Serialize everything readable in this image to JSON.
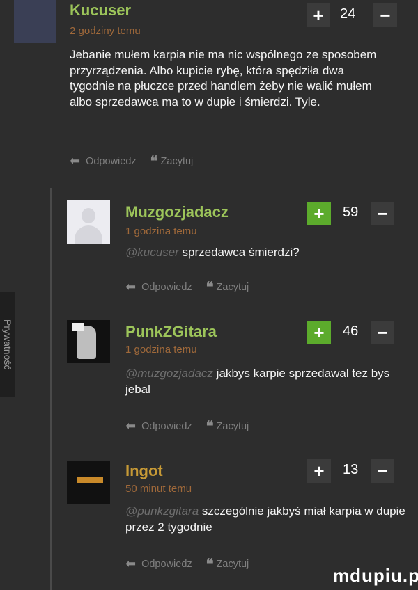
{
  "side_tab": {
    "label": "Prywatność"
  },
  "comments": [
    {
      "username": "Kucuser",
      "timestamp": "2 godziny temu",
      "score": "24",
      "mention": "",
      "text": "Jebanie mułem karpia nie ma nic wspólnego ze sposobem przyrządzenia. Albo kupicie rybę, która spędziła dwa tygodnie na płuczce przed handlem żeby nie walić mułem albo sprzedawca ma to w dupie i śmierdzi. Tyle.",
      "reply_label": "Odpowiedz",
      "quote_label": "Zacytuj"
    },
    {
      "username": "Muzgozjadacz",
      "timestamp": "1 godzina temu",
      "score": "59",
      "mention": "@kucuser",
      "text": "sprzedawca śmierdzi?",
      "reply_label": "Odpowiedz",
      "quote_label": "Zacytuj"
    },
    {
      "username": "PunkZGitara",
      "timestamp": "1 godzina temu",
      "score": "46",
      "mention": "@muzgozjadacz",
      "text": "jakbys karpie sprzedawal tez bys jebal",
      "reply_label": "Odpowiedz",
      "quote_label": "Zacytuj"
    },
    {
      "username": "Ingot",
      "timestamp": "50 minut temu",
      "score": "13",
      "mention": "@punkzgitara",
      "text": "szczególnie jakbyś miał karpia w dupie przez 2 tygodnie",
      "reply_label": "Odpowiedz",
      "quote_label": "Zacytuj"
    }
  ],
  "vote": {
    "up_symbol": "+",
    "down_symbol": "−"
  },
  "icons": {
    "reply": "reply-arrow-icon",
    "quote": "quote-icon"
  },
  "colors": {
    "username": "#9cc45a",
    "timestamp": "#a0693a",
    "upvote_active": "#5cab2c"
  },
  "watermark": {
    "text": "mdupiu.pl"
  }
}
